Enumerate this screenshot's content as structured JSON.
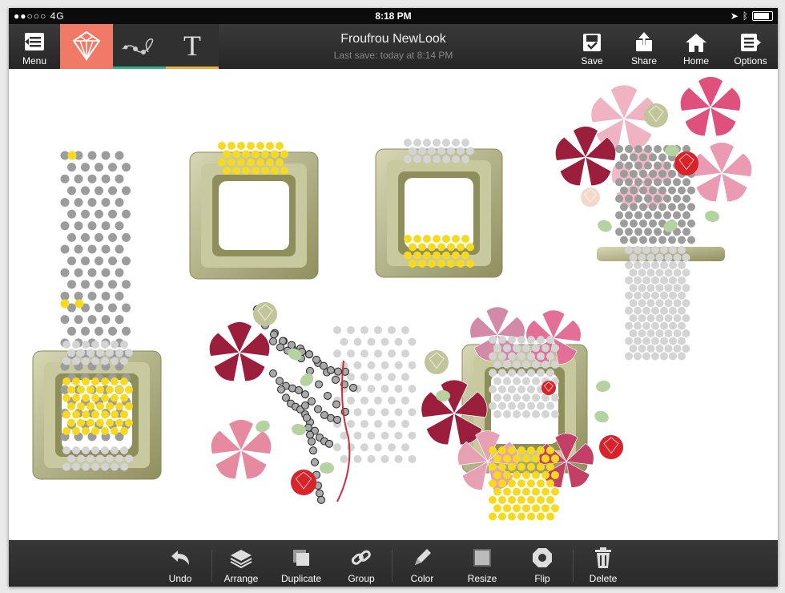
{
  "statusbar": {
    "signal": "●●○○○",
    "network": "4G",
    "time": "8:18 PM"
  },
  "toolbar": {
    "menu_label": "Menu",
    "design_title": "Froufrou NewLook",
    "last_save": "Last save: today at 8:14 PM",
    "save_label": "Save",
    "share_label": "Share",
    "home_label": "Home",
    "options_label": "Options",
    "mode_tabs": [
      {
        "icon": "bead-gem-icon",
        "active": true,
        "accent": "#f07a66"
      },
      {
        "icon": "bead-string-icon",
        "active": false,
        "accent": "#2fb28a"
      },
      {
        "icon": "text-icon",
        "glyph": "T",
        "active": false,
        "accent": "#e6b43c"
      }
    ]
  },
  "bottombar": {
    "undo_label": "Undo",
    "arrange_label": "Arrange",
    "duplicate_label": "Duplicate",
    "group_label": "Group",
    "color_label": "Color",
    "resize_label": "Resize",
    "flip_label": "Flip",
    "delete_label": "Delete"
  },
  "colors": {
    "bead_gray": "#9c9c9c",
    "bead_yellow": "#f7da1d",
    "bead_light": "#d4d4d4",
    "frame_olive": "#a8a878",
    "flower_pink": "#e68aa2",
    "flower_burgundy": "#9b1e3c",
    "crystal_red": "#d8232a",
    "leaf_green": "#b4d3a0"
  }
}
